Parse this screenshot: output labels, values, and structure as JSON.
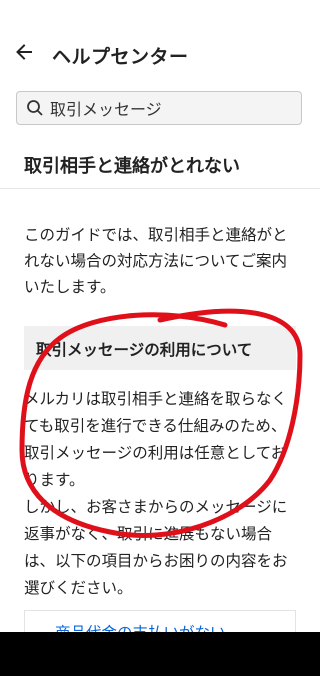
{
  "header": {
    "title": "ヘルプセンター",
    "back_icon": "arrow-left-icon"
  },
  "search": {
    "value": "取引メッセージ",
    "icon": "search-icon"
  },
  "article": {
    "title": "取引相手と連絡がとれない",
    "intro": "このガイドでは、取引相手と連絡がとれない場合の対応方法についてご案内いたします。",
    "section_heading": "取引メッセージの利用について",
    "paragraph1": "メルカリは取引相手と連絡を取らなくても取引を進行できる仕組みのため、取引メッセージの利用は任意としております。",
    "paragraph2": "しかし、お客さまからのメッセージに返事がなく、取引に進展もない場合は、以下の項目からお困りの内容をお選びください。"
  },
  "links": [
    {
      "label": "商品代金の支払いがない"
    }
  ],
  "colors": {
    "annotation": "#e0101a",
    "link": "#0a66d8",
    "section_bg": "#f0f0f0"
  }
}
